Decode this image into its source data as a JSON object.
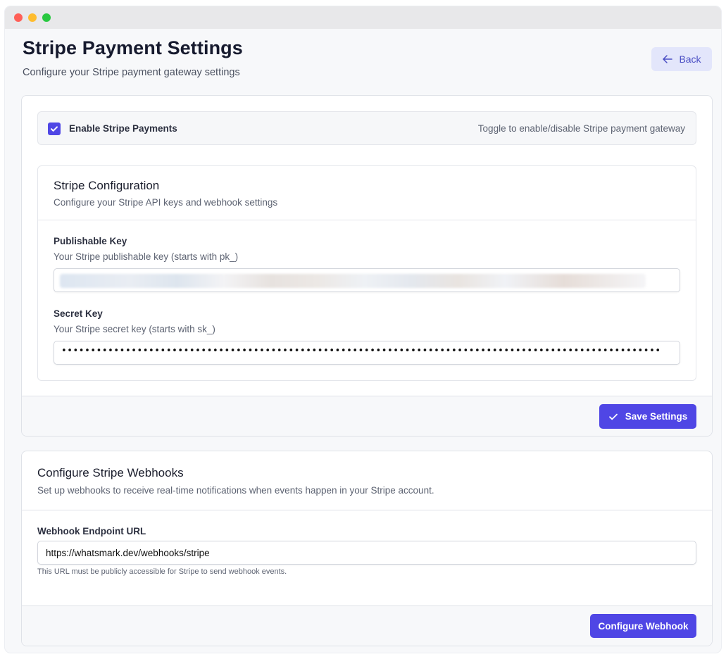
{
  "header": {
    "title": "Stripe Payment Settings",
    "subtitle": "Configure your Stripe payment gateway settings",
    "back_label": "Back"
  },
  "enable": {
    "label": "Enable Stripe Payments",
    "checked": true,
    "hint": "Toggle to enable/disable Stripe payment gateway"
  },
  "config": {
    "title": "Stripe Configuration",
    "subtitle": "Configure your Stripe API keys and webhook settings",
    "publishable": {
      "label": "Publishable Key",
      "help": "Your Stripe publishable key (starts with pk_)",
      "value_state": "blurred"
    },
    "secret": {
      "label": "Secret Key",
      "help": "Your Stripe secret key (starts with sk_)",
      "masked_value": "•••••••••••••••••••••••••••••••••••••••••••••••••••••••••••••••••••••••••••••••••••••••••••••••••••••••"
    },
    "save_label": "Save Settings"
  },
  "webhooks": {
    "title": "Configure Stripe Webhooks",
    "subtitle": "Set up webhooks to receive real-time notifications when events happen in your Stripe account.",
    "url_label": "Webhook Endpoint URL",
    "url_value": "https://whatsmark.dev/webhooks/stripe",
    "url_hint": "This URL must be publicly accessible for Stripe to send webhook events.",
    "configure_label": "Configure Webhook"
  },
  "colors": {
    "accent": "#4f46e5",
    "back_bg": "#e3e6fb"
  },
  "icons": {
    "back": "arrow-left-icon",
    "check": "check-icon"
  }
}
